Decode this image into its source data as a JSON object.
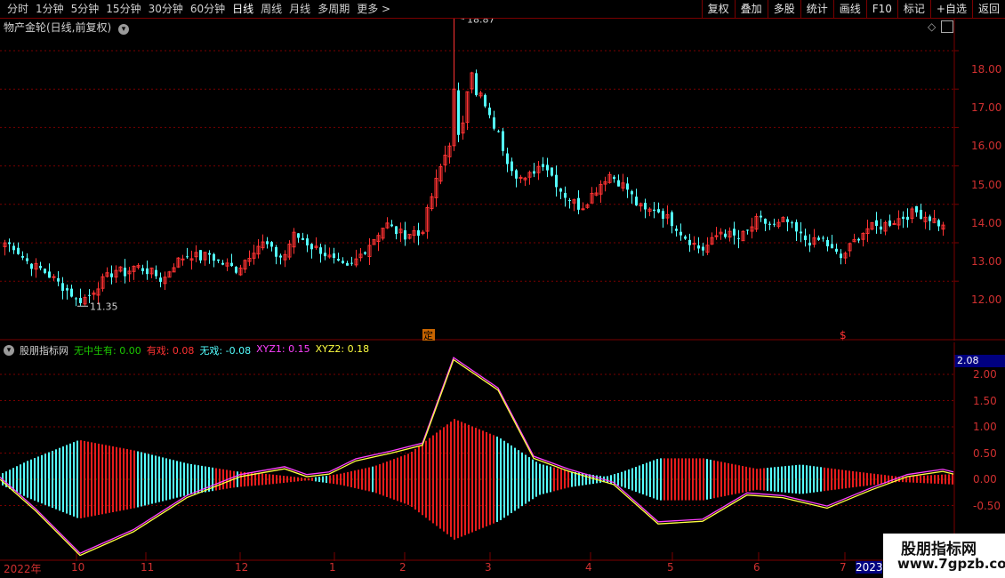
{
  "toolbar": {
    "periods": [
      {
        "label": "分时"
      },
      {
        "label": "1分钟"
      },
      {
        "label": "5分钟"
      },
      {
        "label": "15分钟"
      },
      {
        "label": "30分钟"
      },
      {
        "label": "60分钟"
      },
      {
        "label": "日线",
        "active": true
      },
      {
        "label": "周线"
      },
      {
        "label": "月线"
      },
      {
        "label": "多周期"
      },
      {
        "label": "更多 >"
      }
    ],
    "buttons": [
      "复权",
      "叠加",
      "多股",
      "统计",
      "画线",
      "F10",
      "标记",
      "+自选",
      "返回"
    ]
  },
  "main_panel": {
    "title": "物产金轮(日线,前复权)",
    "high_label": "18.87",
    "low_label": "11.35",
    "event_marks": [
      "定",
      "$"
    ],
    "colors": {
      "up": "#ff3232",
      "down": "#54ffff",
      "axis": "#d03030",
      "grid": "#7a0000"
    }
  },
  "indicator_panel": {
    "name": "股朋指标网",
    "series": [
      {
        "label": "无中生有:",
        "value": "0.00",
        "color": "#1cc800"
      },
      {
        "label": "有戏:",
        "value": "0.08",
        "color": "#ff3232"
      },
      {
        "label": "无戏:",
        "value": "-0.08",
        "color": "#54ffff"
      },
      {
        "label": "XYZ1:",
        "value": "0.15",
        "color": "#ff40ff"
      },
      {
        "label": "XYZ2:",
        "value": "0.18",
        "color": "#ffff40"
      }
    ],
    "current_value": "2.08"
  },
  "price_axis": [
    "18.00",
    "17.00",
    "16.00",
    "15.00",
    "14.00",
    "13.00",
    "12.00"
  ],
  "indicator_axis": [
    "2.00",
    "1.50",
    "1.00",
    "0.50",
    "0.00",
    "-0.50"
  ],
  "date_axis": [
    "2022年",
    "10",
    "11",
    "12",
    "1",
    "2",
    "3",
    "4",
    "5",
    "6",
    "7",
    "2023"
  ],
  "watermark": {
    "line1": "股朋指标网",
    "line2": "www.7gpzb.com"
  },
  "chart_data": {
    "type": "candlestick",
    "series_note": "",
    "price_high": 18.87,
    "price_low": 11.35,
    "close_path": [
      13.0,
      12.9,
      12.6,
      12.4,
      12.3,
      12.1,
      11.9,
      11.7,
      11.5,
      11.6,
      11.9,
      12.1,
      12.3,
      12.2,
      12.4,
      12.3,
      12.2,
      12.0,
      12.4,
      12.6,
      12.7,
      12.6,
      12.7,
      12.5,
      12.4,
      12.3,
      12.6,
      12.9,
      13.0,
      12.7,
      12.6,
      13.2,
      13.1,
      12.9,
      12.8,
      12.6,
      12.4,
      12.3,
      12.6,
      12.9,
      13.2,
      13.5,
      13.3,
      13.2,
      13.3,
      13.1,
      13.4,
      13.6,
      13.7,
      13.8,
      16.2,
      17.0,
      16.3,
      15.9,
      15.2,
      14.8,
      14.6,
      14.9,
      15.1,
      14.7,
      14.3,
      14.1,
      13.9,
      14.2,
      14.5,
      14.8,
      14.6,
      14.4,
      14.0,
      13.8,
      13.9,
      13.7,
      13.5,
      13.2,
      13.0,
      12.8,
      13.0,
      13.3,
      13.2,
      13.1,
      13.3,
      13.6,
      13.5,
      13.4,
      13.6,
      13.3,
      13.1,
      13.0,
      13.1,
      12.8,
      12.6,
      12.9,
      13.2,
      13.4,
      13.4,
      13.5,
      13.6,
      13.7,
      13.8,
      13.7,
      13.6,
      13.4
    ]
  }
}
